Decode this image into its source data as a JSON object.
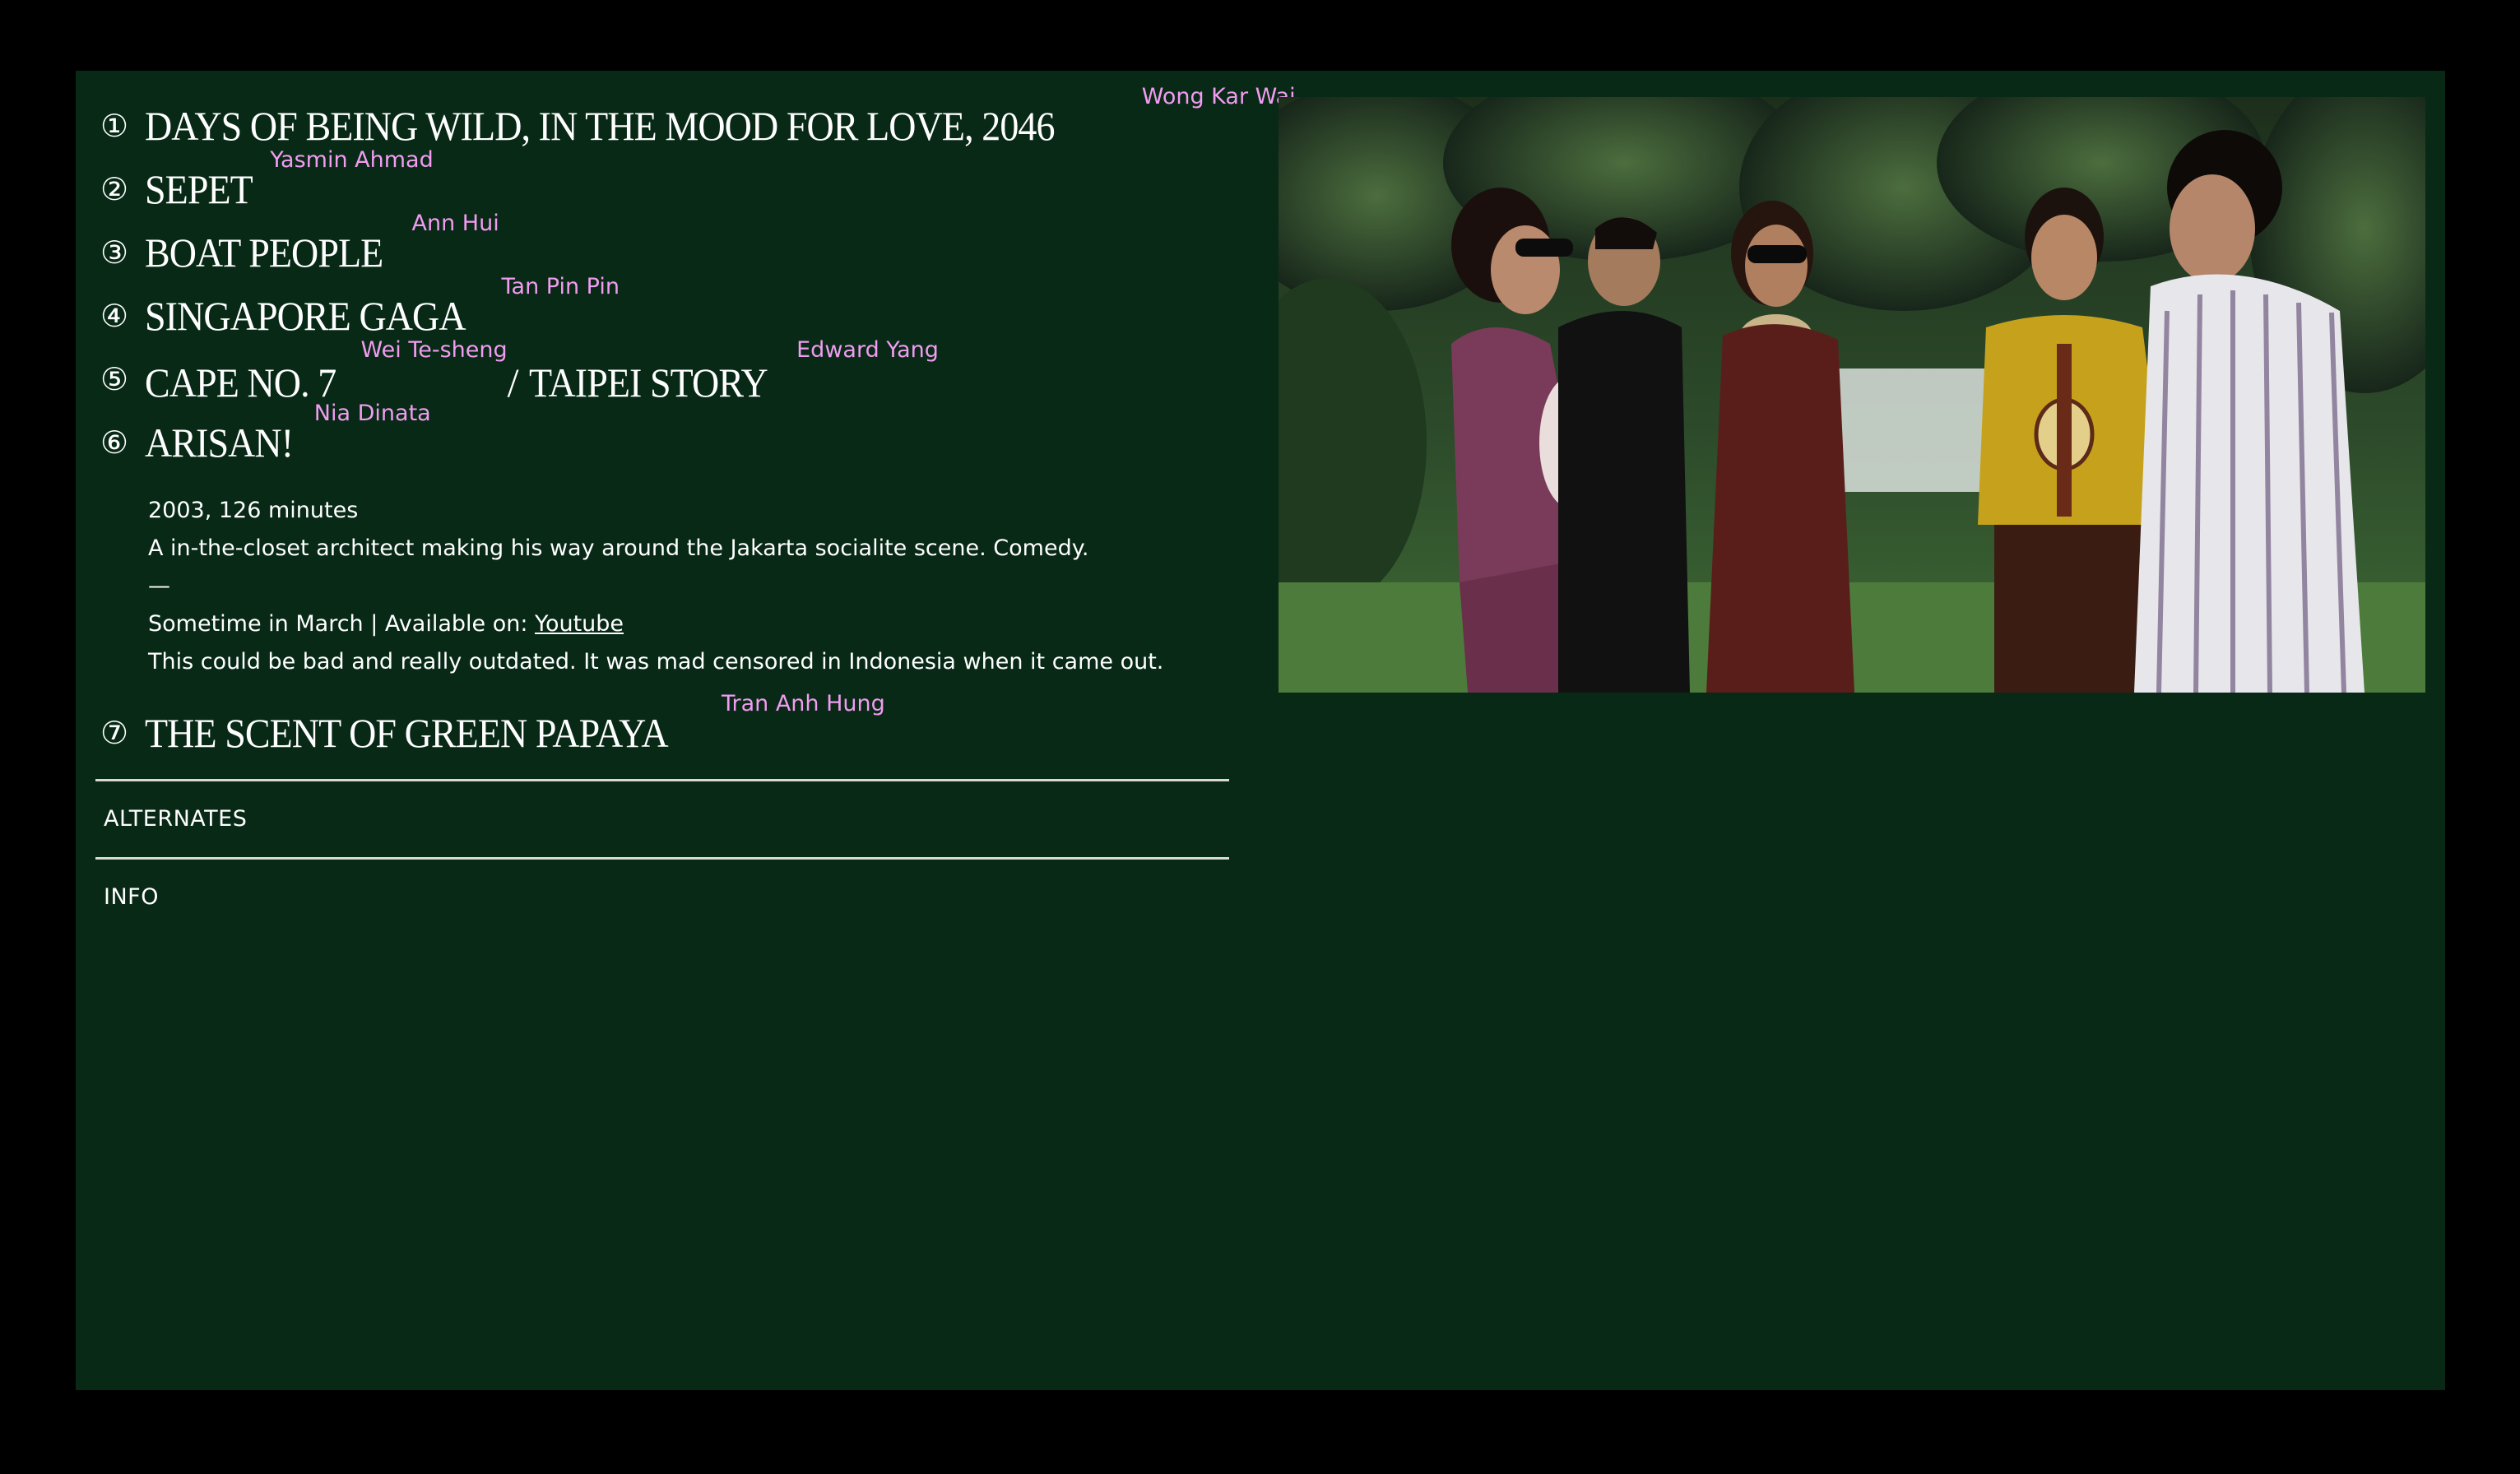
{
  "films": [
    {
      "number": "①",
      "entries": [
        {
          "title": "DAYS OF BEING WILD,  IN THE MOOD FOR LOVE,  2046",
          "director": "Wong Kar Wai"
        }
      ]
    },
    {
      "number": "②",
      "entries": [
        {
          "title": "SEPET",
          "director": "Yasmin Ahmad"
        }
      ]
    },
    {
      "number": "③",
      "entries": [
        {
          "title": "BOAT PEOPLE",
          "director": "Ann Hui"
        }
      ]
    },
    {
      "number": "④",
      "entries": [
        {
          "title": "SINGAPORE GAGA",
          "director": "Tan Pin Pin"
        }
      ]
    },
    {
      "number": "⑤",
      "entries": [
        {
          "title": "CAPE NO. 7",
          "director": "Wei Te-sheng"
        },
        {
          "separator": "/ ",
          "title": "TAIPEI STORY",
          "director": "Edward Yang"
        }
      ]
    },
    {
      "number": "⑥",
      "entries": [
        {
          "title": "ARISAN!",
          "director": "Nia Dinata"
        }
      ],
      "details": {
        "year_runtime": "2003, 126 minutes",
        "synopsis": "A in-the-closet architect making his way around the Jakarta socialite scene. Comedy.",
        "dash": "—",
        "schedule_prefix": "Sometime in March | Available on: ",
        "platform_link": "Youtube",
        "note": "This could be bad and really outdated. It was mad censored in Indonesia when it came out."
      }
    },
    {
      "number": "⑦",
      "entries": [
        {
          "title": "THE SCENT OF GREEN PAPAYA",
          "director": "Tran Anh Hung"
        }
      ]
    }
  ],
  "sections": {
    "alternates": "ALTERNATES",
    "info": "INFO"
  },
  "colors": {
    "page_background": "#000000",
    "panel_background": "#072916",
    "text": "#ffffff",
    "director_accent": "#f29cf0",
    "divider": "#d9d9d4"
  },
  "photo": {
    "subject": "film-still-photo"
  }
}
